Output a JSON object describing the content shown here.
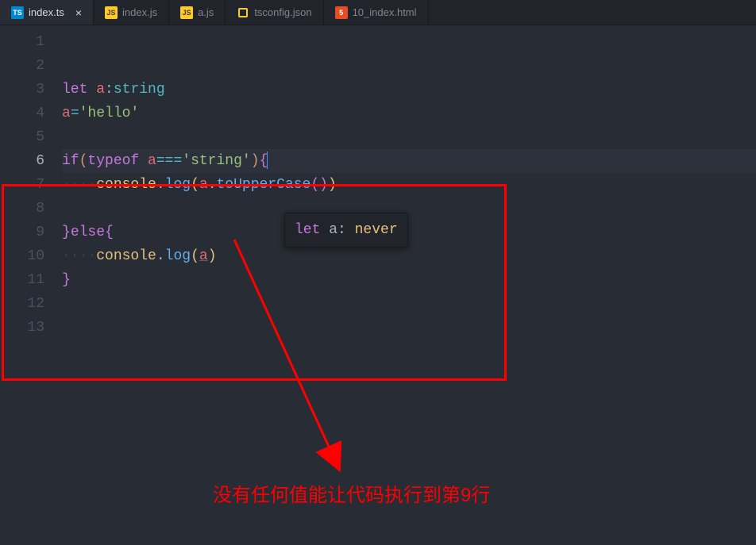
{
  "tabs": [
    {
      "icon": "TS",
      "iconClass": "icon-ts",
      "label": "index.ts",
      "active": true,
      "closable": true
    },
    {
      "icon": "JS",
      "iconClass": "icon-js",
      "label": "index.js",
      "active": false,
      "closable": false
    },
    {
      "icon": "JS",
      "iconClass": "icon-js",
      "label": "a.js",
      "active": false,
      "closable": false
    },
    {
      "icon": "",
      "iconClass": "icon-json",
      "label": "tsconfig.json",
      "active": false,
      "closable": false
    },
    {
      "icon": "5",
      "iconClass": "icon-html",
      "label": "10_index.html",
      "active": false,
      "closable": false
    }
  ],
  "gutter": {
    "start": 1,
    "end": 13,
    "current": 6
  },
  "code": {
    "l3": {
      "let": "let",
      "sp": " ",
      "a": "a",
      "colon": ":",
      "type": "string"
    },
    "l4": {
      "a": "a",
      "eq": "=",
      "str": "'hello'"
    },
    "l6": {
      "if": "if",
      "lp": "(",
      "typeof": "typeof",
      "sp": " ",
      "a": "a",
      "eqeq": "===",
      "str": "'string'",
      "rp": ")",
      "lb": "{"
    },
    "l7": {
      "ws": "····",
      "obj": "console",
      "dot1": ".",
      "log": "log",
      "lp": "(",
      "a": "a",
      "dot2": ".",
      "fn": "toUpperCase",
      "lp2": "(",
      "rp2": ")",
      "rp": ")"
    },
    "l9": {
      "rb": "}",
      "else": "else",
      "lb": "{"
    },
    "l10": {
      "ws": "····",
      "obj": "console",
      "dot": ".",
      "log": "log",
      "lp": "(",
      "a": "a",
      "rp": ")"
    },
    "l11": {
      "rb": "}"
    }
  },
  "tooltip": {
    "let": "let",
    "name": " a",
    "colon": ": ",
    "type": "never"
  },
  "annotation": "没有任何值能让代码执行到第9行",
  "closeGlyph": "×"
}
